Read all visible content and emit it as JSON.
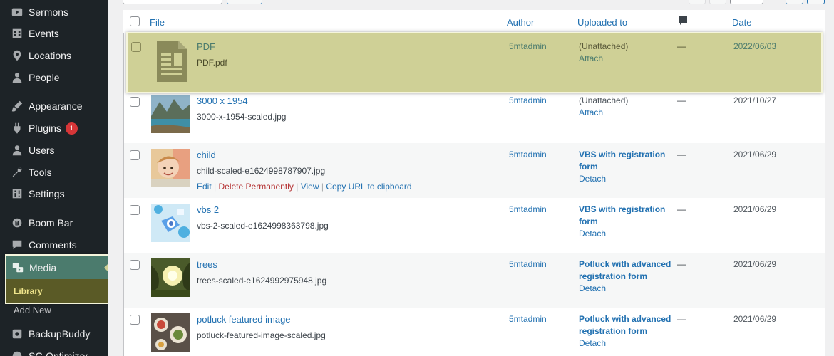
{
  "sidebar": {
    "items": [
      {
        "label": "Sermons",
        "icon": "video-icon"
      },
      {
        "label": "Events",
        "icon": "building-icon"
      },
      {
        "label": "Locations",
        "icon": "location-pin-icon"
      },
      {
        "label": "People",
        "icon": "person-icon"
      },
      {
        "label": "Appearance",
        "icon": "paintbrush-icon"
      },
      {
        "label": "Plugins",
        "icon": "plug-icon",
        "badge": "1"
      },
      {
        "label": "Users",
        "icon": "user-icon"
      },
      {
        "label": "Tools",
        "icon": "wrench-icon"
      },
      {
        "label": "Settings",
        "icon": "sliders-icon"
      },
      {
        "label": "Boom Bar",
        "icon": "circle-b-icon"
      },
      {
        "label": "Comments",
        "icon": "speech-bubble-icon"
      },
      {
        "label": "BackupBuddy",
        "icon": "backup-icon"
      },
      {
        "label": "SG Optimizer",
        "icon": "optimizer-icon"
      }
    ],
    "media": {
      "label": "Media",
      "icon": "media-icon",
      "sub_active": "Library",
      "sub_next": "Add New"
    }
  },
  "table": {
    "headers": {
      "file": "File",
      "author": "Author",
      "uploaded_to": "Uploaded to",
      "comments_icon": "comment-bubble-icon",
      "date": "Date"
    },
    "rows": [
      {
        "title": "PDF",
        "filename": "PDF.pdf",
        "author": "5mtadmin",
        "uploaded": "(Unattached)",
        "uploaded_link": "Attach",
        "comments": "—",
        "date": "2022/06/03",
        "thumb": "document-icon"
      },
      {
        "title": "3000 x 1954",
        "filename": "3000-x-1954-scaled.jpg",
        "author": "5mtadmin",
        "uploaded": "(Unattached)",
        "uploaded_link": "Attach",
        "comments": "—",
        "date": "2021/10/27",
        "thumb": "lake-photo"
      },
      {
        "title": "child",
        "filename": "child-scaled-e1624998787907.jpg",
        "author": "5mtadmin",
        "uploaded_line1": "VBS with registration",
        "uploaded_line2": "form",
        "uploaded_link": "Detach",
        "comments": "—",
        "date": "2021/06/29",
        "thumb": "child-photo",
        "actions": {
          "edit": "Edit",
          "delete": "Delete Permanently",
          "view": "View",
          "copy": "Copy URL to clipboard",
          "sep": "|"
        }
      },
      {
        "title": "vbs 2",
        "filename": "vbs-2-scaled-e1624998363798.jpg",
        "author": "5mtadmin",
        "uploaded_line1": "VBS with registration",
        "uploaded_line2": "form",
        "uploaded_link": "Detach",
        "comments": "—",
        "date": "2021/06/29",
        "thumb": "vbs-photo"
      },
      {
        "title": "trees",
        "filename": "trees-scaled-e1624992975948.jpg",
        "author": "5mtadmin",
        "uploaded_line1": "Potluck with advanced",
        "uploaded_line2": "registration form",
        "uploaded_link": "Detach",
        "comments": "—",
        "date": "2021/06/29",
        "thumb": "trees-photo"
      },
      {
        "title": "potluck featured image",
        "filename": "potluck-featured-image-scaled.jpg",
        "author": "5mtadmin",
        "uploaded_line1": "Potluck with advanced",
        "uploaded_line2": "registration form",
        "uploaded_link": "Detach",
        "comments": "—",
        "date": "2021/06/29",
        "thumb": "food-photo"
      }
    ]
  },
  "colors": {
    "sidebar_bg": "#1d2327",
    "link": "#2271b1",
    "highlight": "#cfd096",
    "media_active": "#4b7b6d"
  }
}
